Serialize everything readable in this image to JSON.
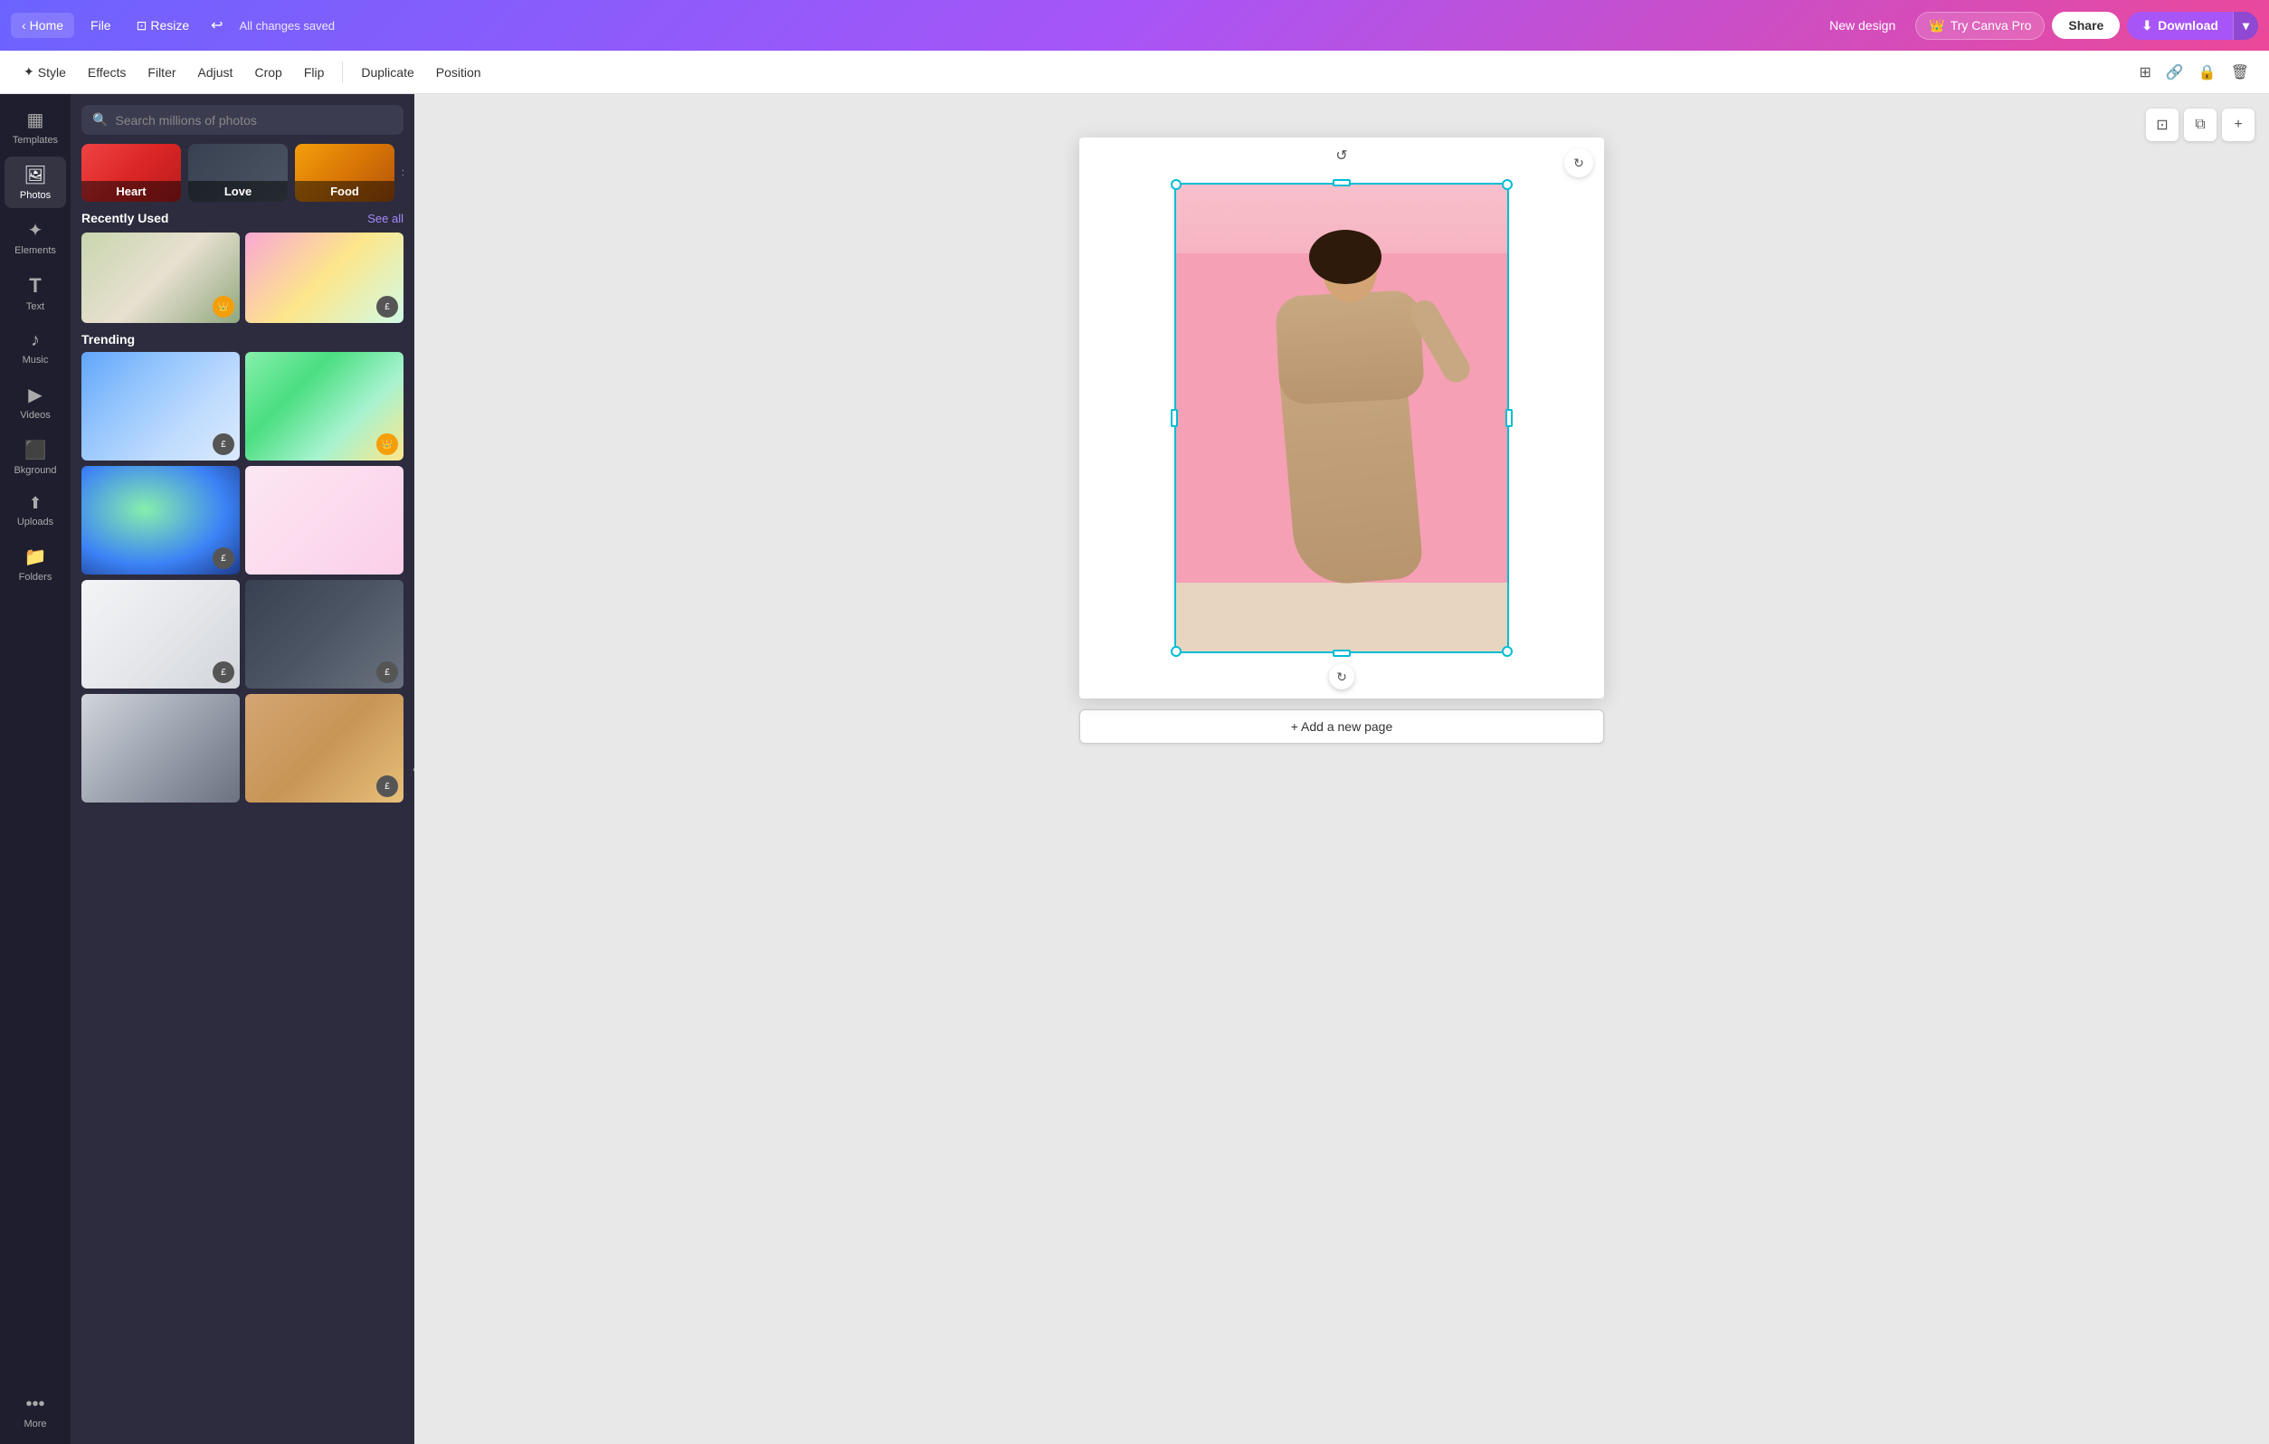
{
  "app": {
    "title": "Canva"
  },
  "topNav": {
    "homeLabel": "Home",
    "fileLabel": "File",
    "resizeLabel": "Resize",
    "savedStatus": "All changes saved",
    "newDesignLabel": "New design",
    "tryProLabel": "Try Canva Pro",
    "shareLabel": "Share",
    "downloadLabel": "Download",
    "crownIcon": "👑"
  },
  "editToolbar": {
    "styleLabel": "Style",
    "effectsLabel": "Effects",
    "filterLabel": "Filter",
    "adjustLabel": "Adjust",
    "cropLabel": "Crop",
    "flipLabel": "Flip",
    "duplicateLabel": "Duplicate",
    "positionLabel": "Position",
    "styleIcon": "✦",
    "gridIcon": "⊞",
    "linkIcon": "🔗",
    "lockIcon": "🔒",
    "deleteIcon": "🗑"
  },
  "sidebar": {
    "items": [
      {
        "id": "templates",
        "label": "Templates",
        "icon": "▦"
      },
      {
        "id": "photos",
        "label": "Photos",
        "icon": "🖼"
      },
      {
        "id": "elements",
        "label": "Elements",
        "icon": "✦"
      },
      {
        "id": "text",
        "label": "Text",
        "icon": "T"
      },
      {
        "id": "music",
        "label": "Music",
        "icon": "♪"
      },
      {
        "id": "videos",
        "label": "Videos",
        "icon": "▶"
      },
      {
        "id": "background",
        "label": "Bkground",
        "icon": "⬛"
      },
      {
        "id": "uploads",
        "label": "Uploads",
        "icon": "↑"
      },
      {
        "id": "folders",
        "label": "Folders",
        "icon": "📁"
      },
      {
        "id": "more",
        "label": "More",
        "icon": "···"
      }
    ]
  },
  "photosPanel": {
    "searchPlaceholder": "Search millions of photos",
    "categories": [
      {
        "id": "heart",
        "label": "Heart",
        "colorClass": "img-heart-pill"
      },
      {
        "id": "love",
        "label": "Love",
        "colorClass": "img-love-pill"
      },
      {
        "id": "food",
        "label": "Food",
        "colorClass": "img-food-pill"
      }
    ],
    "recentlyUsed": {
      "title": "Recently Used",
      "seeAllLabel": "See all",
      "photos": [
        {
          "id": "palm",
          "colorClass": "img-palm",
          "badge": "👑",
          "badgeType": "crown"
        },
        {
          "id": "flowers",
          "colorClass": "img-flowers",
          "badge": "£",
          "badgeType": "pound"
        }
      ]
    },
    "trending": {
      "title": "Trending",
      "photos": [
        {
          "id": "man-cook",
          "colorClass": "img-man-cook",
          "badge": "£",
          "badgeType": "pound"
        },
        {
          "id": "friends",
          "colorClass": "img-friends",
          "badge": "👑",
          "badgeType": "crown"
        },
        {
          "id": "globe",
          "colorClass": "img-globe",
          "badge": "£",
          "badgeType": "pound"
        },
        {
          "id": "woman-pink",
          "colorClass": "img-woman-pink",
          "badge": null
        },
        {
          "id": "kitchen",
          "colorClass": "img-kitchen",
          "badge": "£",
          "badgeType": "pound"
        },
        {
          "id": "fireplace",
          "colorClass": "img-fireplace",
          "badge": "£",
          "badgeType": "pound"
        },
        {
          "id": "blinds",
          "colorClass": "img-blinds",
          "badge": null
        },
        {
          "id": "apron",
          "colorClass": "img-apron",
          "badge": "£",
          "badgeType": "pound"
        }
      ]
    }
  },
  "canvas": {
    "addPageLabel": "+ Add a new page",
    "topButtons": [
      {
        "id": "square",
        "icon": "⊡"
      },
      {
        "id": "copy",
        "icon": "⧉"
      },
      {
        "id": "add",
        "icon": "+"
      }
    ]
  }
}
